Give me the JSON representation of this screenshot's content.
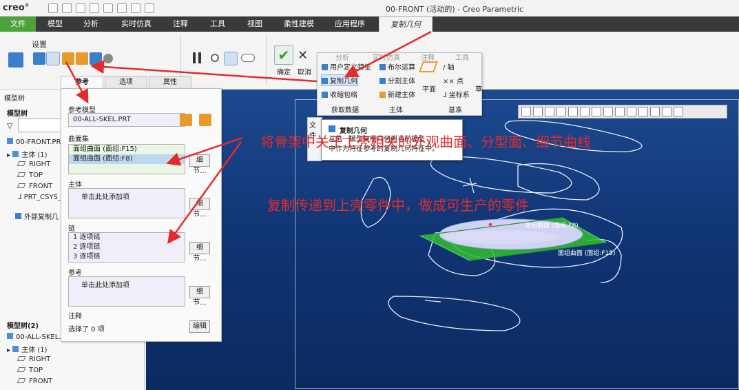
{
  "titlebar": {
    "logo": "creo°",
    "window_title": "00-FRONT (活动的) - Creo Parametric"
  },
  "ribbon_tabs": [
    "文件",
    "模型",
    "分析",
    "实时仿真",
    "注释",
    "工具",
    "视图",
    "柔性建模",
    "应用程序",
    "复制几何"
  ],
  "ribbon": {
    "group_settings": "设置",
    "ok_label": "确定",
    "cancel_label": "取消"
  },
  "dashboard_tabs": [
    "参考",
    "选项",
    "属性"
  ],
  "left_tree": {
    "tab_model_tree": "模型树",
    "header": "模型树",
    "items": [
      "00-FRONT.PRT",
      "主体 (1)",
      "RIGHT",
      "TOP",
      "FRONT",
      "PRT_CSYS_",
      "外部复制几"
    ],
    "header2": "模型树(2)",
    "items2": [
      "00-ALL-SKEL.P",
      "主体 (1)",
      "RIGHT",
      "TOP",
      "FRONT"
    ]
  },
  "ref_panel": {
    "ref_model_label": "参考模型",
    "ref_model_value": "00-ALL-SKEL.PRT",
    "surface_set_label": "曲面集",
    "surfaces": [
      "面组曲面 (面组:F15)",
      "面组曲面 (面组:F8)"
    ],
    "detail_btn": "细节...",
    "body_label": "主体",
    "body_placeholder": "单击此处添加项",
    "chain_label": "链",
    "chains": [
      "1 逐项链",
      "2 逐项链",
      "3 逐项链"
    ],
    "reference_label": "参考",
    "reference_placeholder": "单击此处添加项",
    "note_label": "注释",
    "note_value": "选择了 0 项",
    "edit_btn": "编辑"
  },
  "pop_group": {
    "header": [
      "分析",
      "实时仿真",
      "注释",
      "工具"
    ],
    "items": [
      "用户定义特征",
      "复制几何",
      "收缩包络",
      "布尔运算",
      "分割主体",
      "新建主体",
      "轴",
      "点",
      "坐标系",
      "平面",
      "草"
    ],
    "group_labels": [
      "获取数据",
      "主体",
      "基准"
    ]
  },
  "tooltip": {
    "file_tag": "文件",
    "title": "复制几何",
    "body": "中作为特征参考的复制几何特征中。",
    "body_prefix": "从另一模型复制几何",
    "body_middle": "到当前模型"
  },
  "viewport": {
    "label1": "面组曲面 (面组:F8)",
    "label2": "面组曲面 (面组:F15)"
  },
  "annotations": {
    "line1": "将骨架中关于上壳相关的外观曲面、分型面、细节曲线",
    "line2": "复制传递到上壳零件中，做成可生产的零件"
  },
  "colors": {
    "file_tab": "#4da23a",
    "annotation": "#e32b2b",
    "viewport_top": "#1e4a90",
    "selection": "#bcd8ef"
  }
}
